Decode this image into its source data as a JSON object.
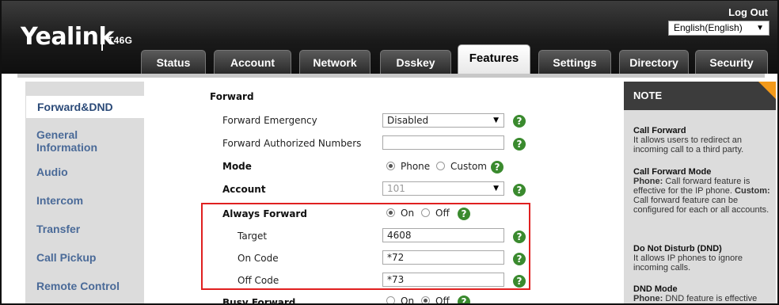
{
  "header": {
    "brand": "Yealink",
    "model": "T46G",
    "logout": "Log Out",
    "language": "English(English)"
  },
  "tabs": [
    "Status",
    "Account",
    "Network",
    "Dsskey",
    "Features",
    "Settings",
    "Directory",
    "Security"
  ],
  "active_tab": "Features",
  "sidebar": {
    "items": [
      {
        "label": "Forward&DND"
      },
      {
        "label": "General Information"
      },
      {
        "label": "Audio"
      },
      {
        "label": "Intercom"
      },
      {
        "label": "Transfer"
      },
      {
        "label": "Call Pickup"
      },
      {
        "label": "Remote Control"
      }
    ]
  },
  "form": {
    "section_title": "Forward",
    "forward_emergency": {
      "label": "Forward Emergency",
      "value": "Disabled"
    },
    "authorized_numbers": {
      "label": "Forward Authorized Numbers",
      "value": ""
    },
    "mode": {
      "label": "Mode",
      "options": [
        "Phone",
        "Custom"
      ],
      "selected": "Phone"
    },
    "account": {
      "label": "Account",
      "value": "101"
    },
    "always_forward": {
      "label": "Always Forward",
      "options": [
        "On",
        "Off"
      ],
      "selected": "On"
    },
    "target": {
      "label": "Target",
      "value": "4608"
    },
    "on_code": {
      "label": "On Code",
      "value": "*72"
    },
    "off_code": {
      "label": "Off Code",
      "value": "*73"
    },
    "busy_forward": {
      "label": "Busy Forward",
      "options": [
        "On",
        "Off"
      ],
      "selected": "Off"
    }
  },
  "note": {
    "title": "NOTE",
    "sections": [
      {
        "heading": "Call Forward",
        "text": "It allows users to redirect an incoming call to a third party."
      },
      {
        "heading": "Call Forward Mode",
        "phone_label": "Phone:",
        "phone_text": "Call forward feature is effective for the IP phone.",
        "custom_label": "Custom:",
        "custom_text": "Call forward feature can be configured for each or all accounts."
      },
      {
        "heading": "Do Not Disturb (DND)",
        "text": "It allows IP phones to ignore incoming calls."
      },
      {
        "heading": "DND Mode",
        "phone_label": "Phone:",
        "phone_text": "DND feature is effective"
      }
    ]
  },
  "colors": {
    "header": "#1a1a1a",
    "nav_text": "#4a6a98",
    "help_icon": "#3a8a2e",
    "highlight": "#e02020",
    "note_corner": "#f39a1a"
  }
}
